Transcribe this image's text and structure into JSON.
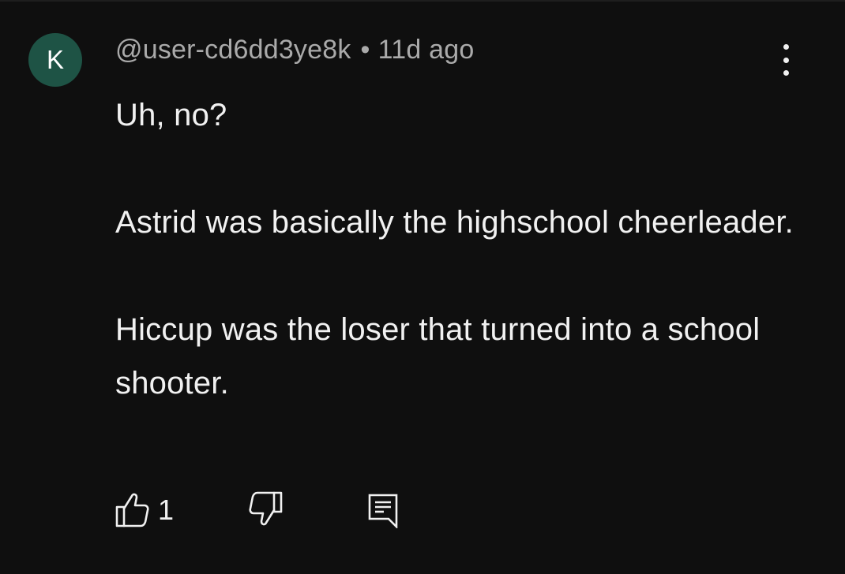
{
  "comment": {
    "avatar_letter": "K",
    "avatar_color": "#1e5345",
    "author": "@user-cd6dd3ye8k",
    "separator": "•",
    "timestamp": "11d ago",
    "paragraphs": [
      "Uh, no?",
      "Astrid was basically the highschool cheerleader.",
      "Hiccup was the loser that turned into a school shooter."
    ],
    "like_count": "1"
  },
  "icons": {
    "menu": "more-vert-icon",
    "like": "thumbs-up-icon",
    "dislike": "thumbs-down-icon",
    "reply": "comment-reply-icon"
  },
  "colors": {
    "background": "#0f0f0f",
    "primary_text": "#f1f1f1",
    "secondary_text": "#aaaaaa"
  }
}
